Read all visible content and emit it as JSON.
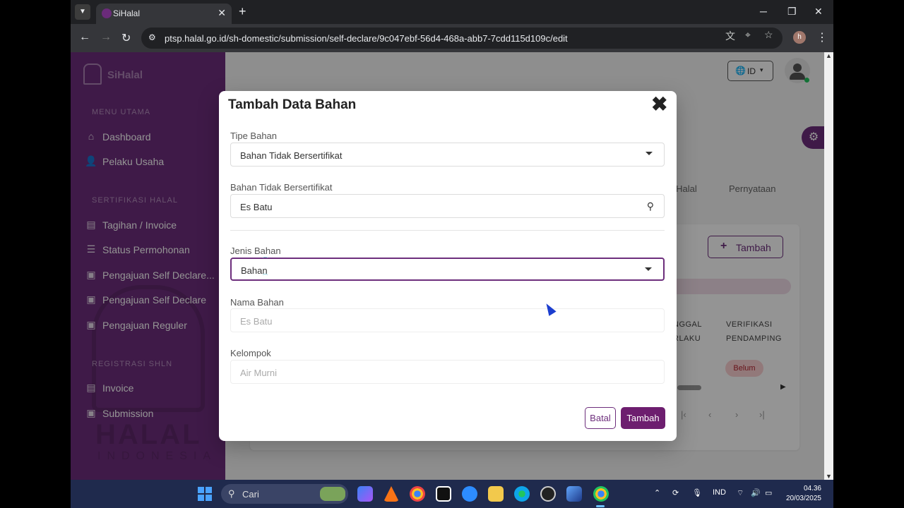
{
  "browser": {
    "tab_title": "SiHalal",
    "url": "ptsp.halal.go.id/sh-domestic/submission/self-declare/9c047ebf-56d4-468a-abb7-7cdd115d109c/edit",
    "profile_initial": "h"
  },
  "sidebar": {
    "brand": "SiHalal",
    "section_main": "MENU UTAMA",
    "section_cert": "SERTIFIKASI HALAL",
    "section_shln": "REGISTRASI SHLN",
    "items": [
      {
        "label": "Dashboard"
      },
      {
        "label": "Pelaku Usaha"
      },
      {
        "label": "Tagihan / Invoice"
      },
      {
        "label": "Status Permohonan"
      },
      {
        "label": "Pengajuan Self Declare..."
      },
      {
        "label": "Pengajuan Self Declare"
      },
      {
        "label": "Pengajuan Reguler"
      },
      {
        "label": "Invoice"
      },
      {
        "label": "Submission"
      }
    ],
    "watermark": "HALAL",
    "watermark_sub": "INDONESIA"
  },
  "header": {
    "lang": "ID"
  },
  "background": {
    "tab_partial": "k Halal",
    "tab_statement": "Pernyataan",
    "add_button": "Tambah",
    "col_date_line1": "NGGAL",
    "col_date_line2": "RLAKU",
    "col_verify_line1": "VERIFIKASI",
    "col_verify_line2": "PENDAMPING",
    "status_badge": "Belum"
  },
  "modal": {
    "title": "Tambah Data Bahan",
    "fields": {
      "type_label": "Tipe Bahan",
      "type_value": "Bahan Tidak Bersertifikat",
      "uncert_label": "Bahan Tidak Bersertifikat",
      "uncert_value": "Es Batu",
      "kind_label": "Jenis Bahan",
      "kind_value": "Bahan",
      "name_label": "Nama Bahan",
      "name_value": "Es Batu",
      "group_label": "Kelompok",
      "group_value": "Air Murni"
    },
    "cancel": "Batal",
    "submit": "Tambah"
  },
  "taskbar": {
    "search": "Cari",
    "lang": "IND",
    "time": "04.36",
    "date": "20/03/2025"
  }
}
